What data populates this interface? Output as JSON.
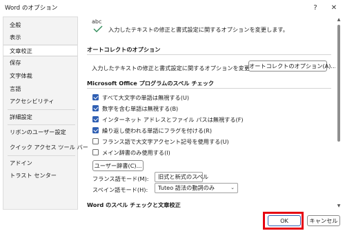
{
  "window": {
    "title": "Word のオプション",
    "help_icon": "?",
    "close_icon": "✕"
  },
  "sidebar": {
    "items": [
      {
        "label": "全般"
      },
      {
        "label": "表示"
      },
      {
        "label": "文章校正",
        "active": true
      },
      {
        "label": "保存"
      },
      {
        "label": "文字体裁"
      },
      {
        "label": "言語"
      },
      {
        "label": "アクセシビリティ"
      },
      {
        "label": "詳細設定"
      },
      {
        "label": "リボンのユーザー設定"
      },
      {
        "label": "クイック アクセス ツール バー"
      },
      {
        "label": "アドイン"
      },
      {
        "label": "トラスト センター"
      }
    ]
  },
  "header": {
    "icon_text": "abc",
    "description": "入力したテキストの修正と書式設定に関するオプションを変更します。"
  },
  "autocorrect": {
    "title": "オートコレクトのオプション",
    "description": "入力したテキストの修正と書式設定に関するオプションを変更します。",
    "button_label": "オートコレクトのオプション(A)..."
  },
  "spelling": {
    "title": "Microsoft Office プログラムのスペル チェック",
    "options": [
      {
        "label": "すべて大文字の単語は無視する(U)",
        "checked": true
      },
      {
        "label": "数字を含む単語は無視する(B)",
        "checked": true
      },
      {
        "label": "インターネット アドレスとファイル パスは無視する(F)",
        "checked": true
      },
      {
        "label": "繰り返し使われる単語にフラグを付ける(R)",
        "checked": true
      },
      {
        "label": "フランス語で大文字アクセント記号を使用する(U)",
        "checked": false
      },
      {
        "label": "メイン辞書のみ使用する(I)",
        "checked": false
      }
    ],
    "custom_dict_button": "ユーザー辞書(C)...",
    "french_mode_label": "フランス語モード(M):",
    "french_mode_value": "旧式と新式のスペル",
    "spanish_mode_label": "スペイン語モード(H):",
    "spanish_mode_value": "Tuteo 語法の動詞のみ"
  },
  "word_section": {
    "title": "Word のスペル チェックと文章校正"
  },
  "footer": {
    "ok_label": "OK",
    "cancel_label": "キャンセル"
  },
  "colors": {
    "accent": "#2f5fb3",
    "highlight": "#e60012"
  }
}
